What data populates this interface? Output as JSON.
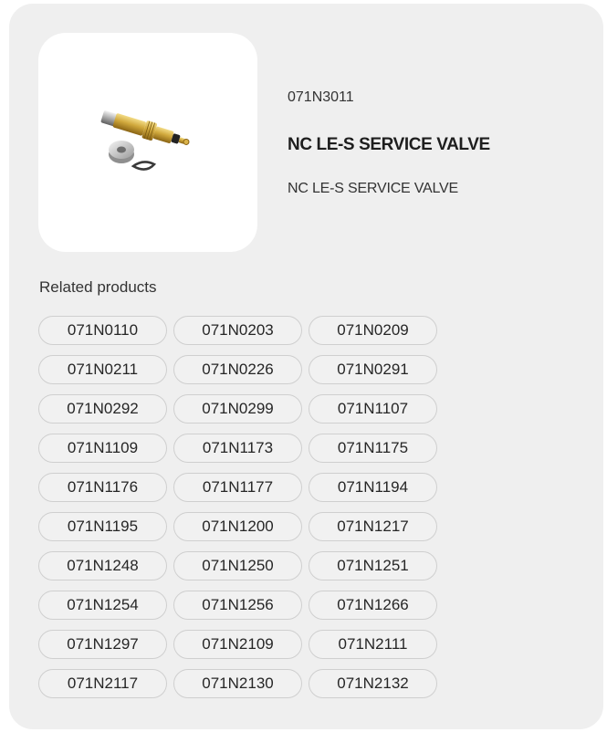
{
  "product": {
    "image_icon": "valve-photo",
    "code": "071N3011",
    "title": "NC LE-S SERVICE VALVE",
    "description": "NC LE-S SERVICE VALVE"
  },
  "related": {
    "heading": "Related products",
    "items": [
      "071N0110",
      "071N0203",
      "071N0209",
      "071N0211",
      "071N0226",
      "071N0291",
      "071N0292",
      "071N0299",
      "071N1107",
      "071N1109",
      "071N1173",
      "071N1175",
      "071N1176",
      "071N1177",
      "071N1194",
      "071N1195",
      "071N1200",
      "071N1217",
      "071N1248",
      "071N1250",
      "071N1251",
      "071N1254",
      "071N1256",
      "071N1266",
      "071N1297",
      "071N2109",
      "071N2111",
      "071N2117",
      "071N2130",
      "071N2132"
    ]
  },
  "colors": {
    "card_background": "#efefef",
    "chip_border": "#cfcfcf",
    "brass": "#c9a23a"
  }
}
